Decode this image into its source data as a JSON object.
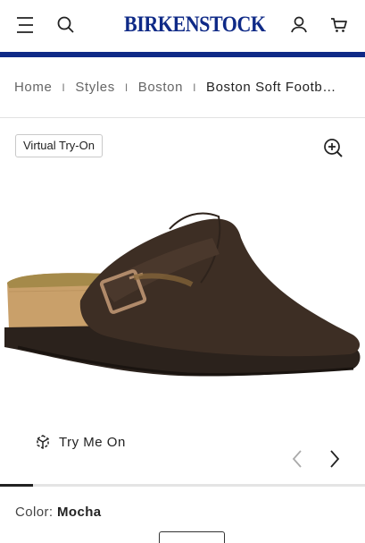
{
  "header": {
    "logo": "BIRKENSTOCK",
    "brand_color": "#0f2a87",
    "icons": [
      "menu-icon",
      "search-icon",
      "account-icon",
      "cart-icon"
    ]
  },
  "breadcrumb": {
    "items": [
      "Home",
      "Styles",
      "Boston"
    ],
    "separator": "I",
    "current": "Boston Soft Footbed Suede Leather"
  },
  "product": {
    "virtual_try_on_label": "Virtual Try-On",
    "try_me_on_label": "Try Me On",
    "image_alt": "Boston Soft Footbed clog in Mocha suede",
    "gallery_progress": 0.09,
    "color_label": "Color:",
    "color_value": "Mocha"
  }
}
